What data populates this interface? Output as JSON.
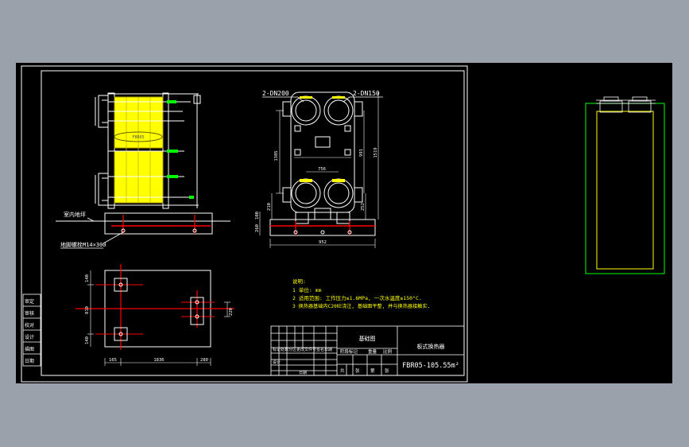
{
  "colors": {
    "workspace": "#9aa1ab",
    "canvas": "#000000",
    "frame": "#ffffff",
    "plate": "#ffff00",
    "outline": "#ffffff",
    "pipe": "#ff0000",
    "green": "#00ff00",
    "dim": "#00ff00",
    "text": "#ffffff",
    "notes": "#ffff00"
  },
  "front_view": {
    "ground_label": "室内地坪",
    "bolt_label": "地脚螺栓M14×300",
    "center_label": "FBR05"
  },
  "side_view": {
    "port_top_left": "2-DN200",
    "port_top_right": "2-DN150",
    "dims": [
      "1385",
      "991",
      "1519",
      "756",
      "210",
      "252",
      "100",
      "260",
      "952"
    ]
  },
  "plan_view": {
    "dims": [
      "165",
      "1836",
      "280",
      "220",
      "810",
      "140",
      "140"
    ]
  },
  "notes": {
    "heading": "说明:",
    "lines": [
      "1  单位: mm",
      "2  适用范围: 工作压力≤1.6MPa, 一次水温度≤150°C.",
      "3  换热器基础内C20砼浇注, 基础面平整, 并与换热器接触实."
    ]
  },
  "title_block": {
    "drawing_name": "基础图",
    "product_type": "板式换热器",
    "model": "FBR05-105.55m²",
    "row_labels": [
      "审定",
      "审核",
      "校对",
      "设计",
      "描图",
      "日期"
    ],
    "stage_labels": [
      "阶段标记",
      "重量",
      "比例"
    ],
    "sheet_labels": [
      "共",
      "张",
      "第",
      "张"
    ],
    "revision_label": "标记处数分区更改文件号签名日期"
  }
}
